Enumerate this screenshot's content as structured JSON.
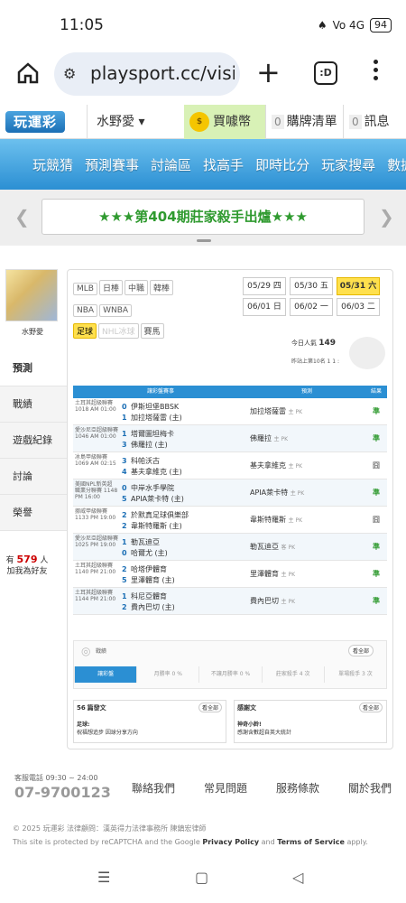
{
  "status": {
    "time": "11:05",
    "icons": "Vo 4G",
    "battery": "94"
  },
  "browser": {
    "url": "playsport.cc/visit",
    "tabs_icon_label": ":D"
  },
  "header": {
    "logo": "玩運彩",
    "user": "水野愛 ▾",
    "buy": "買噱幣",
    "cart_count": "0",
    "cart": "購牌清單",
    "msg_count": "0",
    "msg": "訊息"
  },
  "nav": [
    "玩競猜",
    "預測賽事",
    "討論區",
    "找高手",
    "即時比分",
    "玩家搜尋",
    "數據"
  ],
  "banner": {
    "text": "★★★第404期莊家殺手出爐★★★"
  },
  "sidebar": {
    "name": "水野愛",
    "menu": [
      "預測",
      "戰績",
      "遊戲紀錄",
      "討論",
      "榮譽"
    ],
    "bulb_pre": "有",
    "bulb_count": "579",
    "bulb_unit": "人",
    "bulb_text": "加我為好友"
  },
  "sports": [
    "MLB",
    "日棒",
    "中職",
    "韓棒",
    "NBA",
    "WNBA",
    "足球",
    "NHL冰球",
    "賽馬"
  ],
  "dates": [
    "05/29 四",
    "05/30 五",
    "05/31 六",
    "06/01 日",
    "06/02 一",
    "06/03 二"
  ],
  "popularity": {
    "label": "今日人氣",
    "value": "149",
    "rank": "昨站上第10名 1 1 :"
  },
  "table": {
    "headers": [
      "讓彩盤賽事",
      "預測",
      "結果"
    ],
    "rows": [
      {
        "league": "土耳其超級聯賽 1018 AM 01:00",
        "s1": "0",
        "t1": "伊斯坦堡BBSK",
        "s2": "1",
        "t2": "加拉塔薩雷 (主)",
        "pick": "加拉塔薩雷",
        "side": "主 PK",
        "res": "準"
      },
      {
        "league": "愛沙尼亞超級聯賽 1046 AM 01:00",
        "s1": "1",
        "t1": "塔爾圖坦梅卡",
        "s2": "3",
        "t2": "佛羅拉 (主)",
        "pick": "佛羅拉",
        "side": "主 PK",
        "res": "準"
      },
      {
        "league": "冰島甲級聯賽 1069 AM 02:15",
        "s1": "3",
        "t1": "科帕沃古",
        "s2": "4",
        "t2": "基夫拿維克 (主)",
        "pick": "基夫拿維克",
        "side": "主 PK",
        "res": "囧"
      },
      {
        "league": "美國NPL新英超 職業分聯賽 1148 PM 16:00",
        "s1": "0",
        "t1": "中岸水手學院",
        "s2": "5",
        "t2": "APIA萊卡特 (主)",
        "pick": "APIA萊卡特",
        "side": "主 PK",
        "res": "準"
      },
      {
        "league": "挪威甲級聯賽 1133 PM 19:00",
        "s1": "2",
        "t1": "於默真足球俱樂部",
        "s2": "2",
        "t2": "韋斯特羅斯 (主)",
        "pick": "韋斯特羅斯",
        "side": "主 PK",
        "res": "囧"
      },
      {
        "league": "愛沙尼亞超級聯賽 1025 PM 19:00",
        "s1": "1",
        "t1": "勒瓦迪亞",
        "s2": "0",
        "t2": "哈爾尤 (主)",
        "pick": "勒瓦迪亞",
        "side": "客 PK",
        "res": "準"
      },
      {
        "league": "土耳其超級聯賽 1140 PM 21:00",
        "s1": "2",
        "t1": "哈塔伊體育",
        "s2": "5",
        "t2": "里澤體育 (主)",
        "pick": "里澤體育",
        "side": "主 PK",
        "res": "準"
      },
      {
        "league": "土耳其超級聯賽 1144 PM 21:00",
        "s1": "1",
        "t1": "科尼亞體育",
        "s2": "2",
        "t2": "費內巴切 (主)",
        "pick": "費內巴切",
        "side": "主 PK",
        "res": "準"
      }
    ]
  },
  "record": {
    "title": "戰績",
    "more": "看全部",
    "tabs": [
      "讓彩盤",
      "月勝率 0 %",
      "不讓月勝率 0 %",
      "莊家殺手 4 次",
      "單場殺手 3 次"
    ]
  },
  "articles": [
    {
      "count": "56",
      "title": "篇發文",
      "more": "看全部",
      "item": "足球:",
      "sub": "祝福想追步 因球分享方向"
    },
    {
      "count": "",
      "title": "感謝文",
      "more": "看全部",
      "item": "神奇小鈴!",
      "sub": "感謝含數超自英大統計"
    }
  ],
  "footer": {
    "svc": "客服電話 09:30 ~ 24:00",
    "phone": "07-9700123",
    "links": [
      "聯絡我們",
      "常見問題",
      "服務條款",
      "關於我們"
    ]
  },
  "copyright": {
    "line1": "© 2025 玩運彩 法律顧問：漢英得力法律事務所 陳鎮宏律師",
    "line2a": "This site is protected by reCAPTCHA and the Google ",
    "privacy": "Privacy Policy",
    "and": " and ",
    "terms": "Terms of Service",
    "apply": " apply."
  }
}
